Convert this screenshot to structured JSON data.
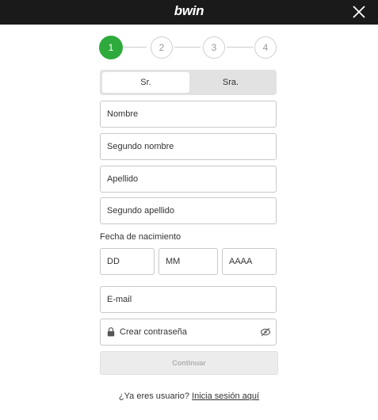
{
  "brand": {
    "logo_text": "bwin"
  },
  "steps": [
    "1",
    "2",
    "3",
    "4"
  ],
  "active_step": 1,
  "gender": {
    "option_1": "Sr.",
    "option_2": "Sra.",
    "selected": "Sr."
  },
  "fields": {
    "first_name": "Nombre",
    "middle_name": "Segundo nombre",
    "last_name": "Apellido",
    "second_last_name": "Segundo apellido"
  },
  "dob": {
    "label": "Fecha de nacimiento",
    "day": "DD",
    "month": "MM",
    "year": "AAAA"
  },
  "email": "E-mail",
  "password": "Crear contraseña",
  "submit": "Continuar",
  "footer": {
    "question": "¿Ya eres usuario?",
    "link": "Inicia sesión aquí"
  },
  "colors": {
    "accent": "#2eaa3c",
    "topbar": "#1a1a1a"
  },
  "icons": {
    "close": "close-icon",
    "lock": "lock-icon",
    "eye": "eye-off-icon"
  }
}
